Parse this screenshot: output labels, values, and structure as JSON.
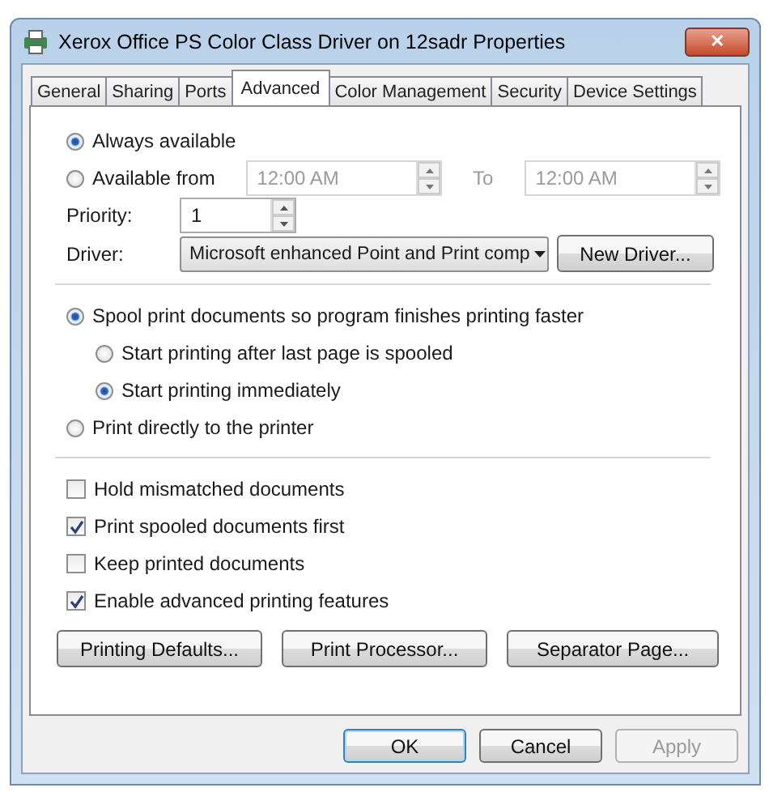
{
  "window": {
    "title": "Xerox Office PS Color Class Driver on 12sadr Properties",
    "close": "✕"
  },
  "tabs": [
    {
      "label": "General",
      "selected": false
    },
    {
      "label": "Sharing",
      "selected": false
    },
    {
      "label": "Ports",
      "selected": false
    },
    {
      "label": "Advanced",
      "selected": true
    },
    {
      "label": "Color Management",
      "selected": false
    },
    {
      "label": "Security",
      "selected": false
    },
    {
      "label": "Device Settings",
      "selected": false
    }
  ],
  "availability": {
    "options": [
      {
        "label": "Always available",
        "selected": true
      },
      {
        "label": "Available from",
        "selected": false
      }
    ],
    "from": {
      "value": "12:00 AM",
      "disabled": true
    },
    "to_label": {
      "text": "To",
      "disabled": true
    },
    "to": {
      "value": "12:00 AM",
      "disabled": true
    }
  },
  "priority": {
    "label": "Priority:",
    "value": "1"
  },
  "driver": {
    "label": "Driver:",
    "value": "Microsoft enhanced Point and Print comp",
    "button": "New Driver..."
  },
  "spool": {
    "options": [
      {
        "label": "Spool print documents so program finishes printing faster",
        "selected": true,
        "children": [
          {
            "label": "Start printing after last page is spooled",
            "selected": false
          },
          {
            "label": "Start printing immediately",
            "selected": true
          }
        ]
      },
      {
        "label": "Print directly to the printer",
        "selected": false
      }
    ]
  },
  "checkboxes": [
    {
      "label": "Hold mismatched documents",
      "checked": false
    },
    {
      "label": "Print spooled documents first",
      "checked": true
    },
    {
      "label": "Keep printed documents",
      "checked": false
    },
    {
      "label": "Enable advanced printing features",
      "checked": true
    }
  ],
  "panel_buttons": [
    "Printing Defaults...",
    "Print Processor...",
    "Separator Page..."
  ],
  "dialog_buttons": [
    {
      "label": "OK",
      "disabled": false,
      "default": true
    },
    {
      "label": "Cancel",
      "disabled": false,
      "default": false
    },
    {
      "label": "Apply",
      "disabled": true,
      "default": false
    }
  ]
}
